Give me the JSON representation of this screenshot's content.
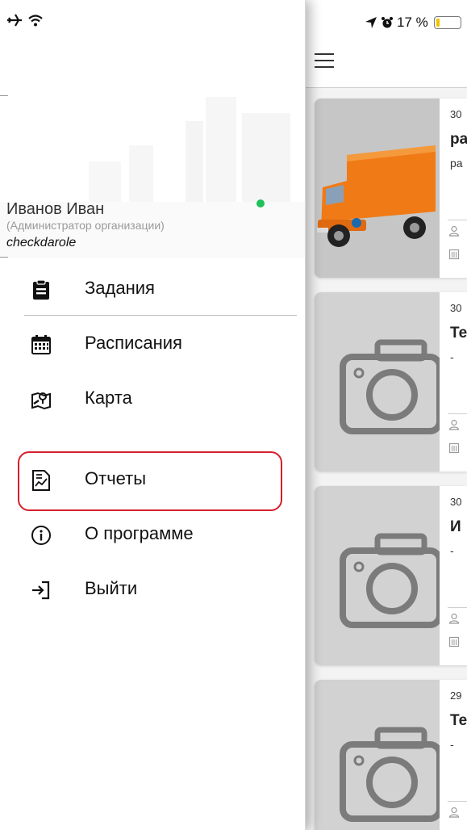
{
  "status_bar": {
    "battery_text": "17 %",
    "battery_level": 0.17,
    "icons": [
      "airplane-icon",
      "wifi-icon",
      "location-arrow-icon",
      "alarm-icon",
      "battery-icon"
    ]
  },
  "drawer": {
    "user": {
      "name": "Иванов Иван",
      "role": "(Администратор организации)",
      "login": "checkdarole",
      "online_color": "#1fc25a"
    },
    "menu": [
      {
        "label": "Задания",
        "icon": "clipboard-icon"
      },
      {
        "label": "Расписания",
        "icon": "calendar-icon"
      },
      {
        "label": "Карта",
        "icon": "map-icon"
      },
      {
        "label": "Отчеты",
        "icon": "report-icon",
        "highlighted": true
      },
      {
        "label": "О программе",
        "icon": "info-icon"
      },
      {
        "label": "Выйти",
        "icon": "logout-icon"
      }
    ],
    "highlight_color": "#d61f2b"
  },
  "main": {
    "cards": [
      {
        "date": "30",
        "title": "ра",
        "subtitle": "ра",
        "image": "truck-photo"
      },
      {
        "date": "30",
        "title": "Те",
        "subtitle": "-",
        "image": "camera-placeholder-icon"
      },
      {
        "date": "30",
        "title": "И",
        "subtitle": "-",
        "image": "camera-placeholder-icon"
      },
      {
        "date": "29",
        "title": "Те",
        "subtitle": "-",
        "image": "camera-placeholder-icon"
      }
    ]
  }
}
